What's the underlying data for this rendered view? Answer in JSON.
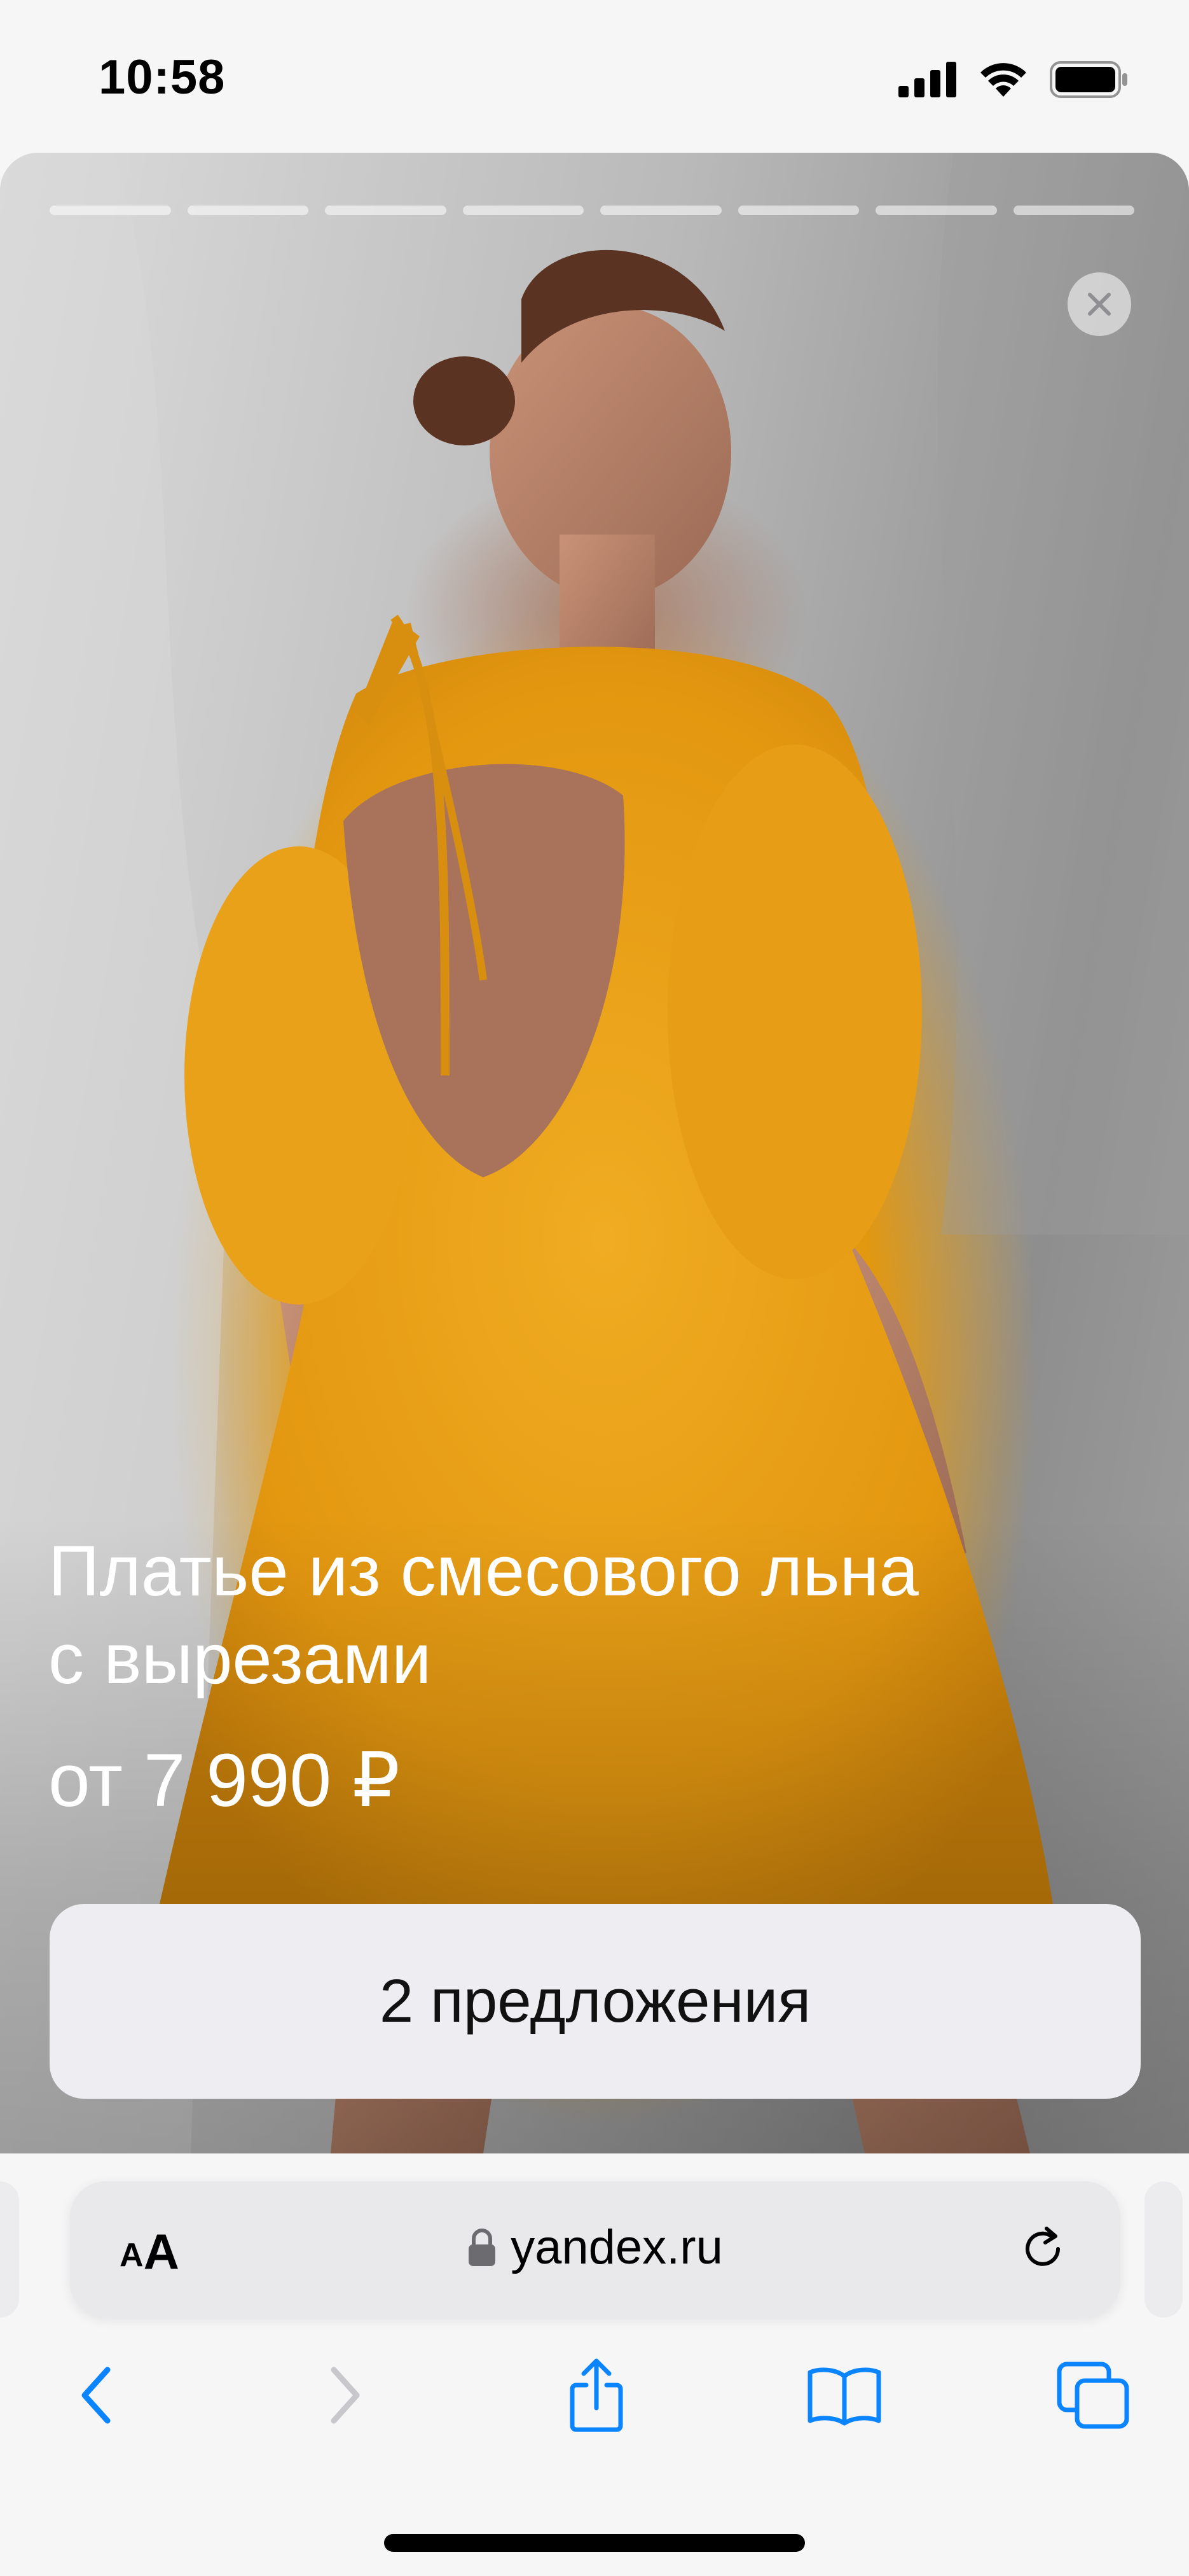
{
  "status_bar": {
    "time": "10:58"
  },
  "story": {
    "progress_segments": 8,
    "product_title_line1": "Платье из смесового льна",
    "product_title_line2": "с вырезами",
    "price": "от 7 990 ₽",
    "offers_button_label": "2 предложения",
    "close_icon": "close-icon"
  },
  "browser": {
    "text_size_small": "A",
    "text_size_big": "A",
    "url": "yandex.ru",
    "icons": {
      "lock": "lock-icon",
      "reload": "reload-icon",
      "back": "chevron-left-icon",
      "forward": "chevron-right-icon",
      "share": "share-icon",
      "bookmarks": "book-icon",
      "tabs": "tabs-icon"
    },
    "colors": {
      "accent": "#0a84ff",
      "disabled": "#c7c7cc"
    }
  }
}
